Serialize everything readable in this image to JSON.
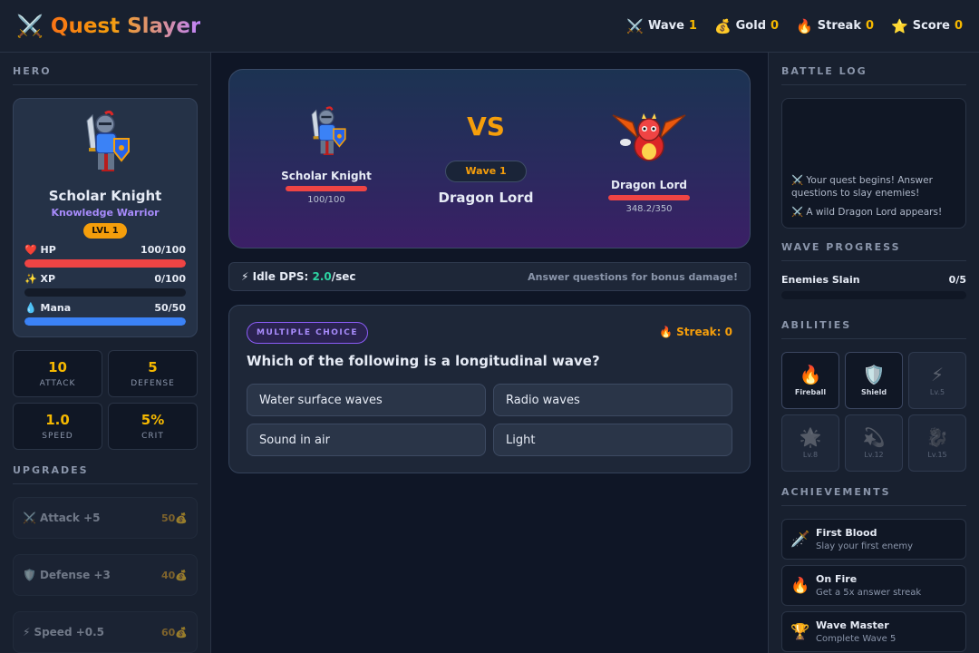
{
  "app": {
    "title": "Quest Slayer",
    "icon": "crossed-swords-icon"
  },
  "header": {
    "stats": [
      {
        "icon": "⚔️",
        "label": "Wave",
        "value": "1"
      },
      {
        "icon": "💰",
        "label": "Gold",
        "value": "0"
      },
      {
        "icon": "🔥",
        "label": "Streak",
        "value": "0"
      },
      {
        "icon": "⭐",
        "label": "Score",
        "value": "0"
      }
    ]
  },
  "hero": {
    "section_title": "HERO",
    "name": "Scholar Knight",
    "class": "Knowledge Warrior",
    "level": "LVL 1",
    "bars": [
      {
        "icon": "❤️",
        "label": "HP",
        "value": "100/100",
        "fraction": 1.0,
        "color": "#ef4444"
      },
      {
        "icon": "✨",
        "label": "XP",
        "value": "0/100",
        "fraction": 0.0,
        "color": "#f59e0b"
      },
      {
        "icon": "💧",
        "label": "Mana",
        "value": "50/50",
        "fraction": 1.0,
        "color": "#3b82f6"
      }
    ],
    "stats": [
      {
        "value": "10",
        "label": "ATTACK"
      },
      {
        "value": "5",
        "label": "DEFENSE"
      },
      {
        "value": "1.0",
        "label": "SPEED"
      },
      {
        "value": "5%",
        "label": "CRIT"
      }
    ]
  },
  "upgrades": {
    "section_title": "UPGRADES",
    "items": [
      {
        "icon": "⚔️",
        "label": "Attack +5",
        "cost": "50💰"
      },
      {
        "icon": "🛡️",
        "label": "Defense +3",
        "cost": "40💰"
      },
      {
        "icon": "⚡",
        "label": "Speed +0.5",
        "cost": "60💰"
      }
    ]
  },
  "battle": {
    "hero_name": "Scholar Knight",
    "hero_hp": "100/100",
    "hero_hp_fraction": 1.0,
    "vs": "VS",
    "wave": "Wave 1",
    "enemy_title": "Dragon Lord",
    "enemy_name": "Dragon Lord",
    "enemy_hp": "348.2/350",
    "enemy_hp_fraction": 0.995
  },
  "idle": {
    "icon": "⚡",
    "label": "Idle DPS:",
    "value": "2.0",
    "unit": "/sec",
    "hint": "Answer questions for bonus damage!"
  },
  "question": {
    "type": "MULTIPLE CHOICE",
    "streak": "🔥 Streak: 0",
    "text": "Which of the following is a longitudinal wave?",
    "answers": [
      "Water surface waves",
      "Radio waves",
      "Sound in air",
      "Light"
    ]
  },
  "battle_log": {
    "section_title": "BATTLE LOG",
    "entries": [
      "⚔️ Your quest begins! Answer questions to slay enemies!",
      "⚔️ A wild Dragon Lord appears!"
    ]
  },
  "wave_progress": {
    "section_title": "WAVE PROGRESS",
    "label": "Enemies Slain",
    "value": "0/5",
    "fraction": 0.0
  },
  "abilities": {
    "section_title": "ABILITIES",
    "items": [
      {
        "icon": "🔥",
        "label": "Fireball",
        "unlocked": true
      },
      {
        "icon": "🛡️",
        "label": "Shield",
        "unlocked": true
      },
      {
        "icon": "⚡",
        "label": "Lv.5",
        "unlocked": false
      },
      {
        "icon": "🌟",
        "label": "Lv.8",
        "unlocked": false
      },
      {
        "icon": "💫",
        "label": "Lv.12",
        "unlocked": false
      },
      {
        "icon": "🐉",
        "label": "Lv.15",
        "unlocked": false
      }
    ]
  },
  "achievements": {
    "section_title": "ACHIEVEMENTS",
    "items": [
      {
        "icon": "🗡️",
        "title": "First Blood",
        "desc": "Slay your first enemy"
      },
      {
        "icon": "🔥",
        "title": "On Fire",
        "desc": "Get a 5x answer streak"
      },
      {
        "icon": "🏆",
        "title": "Wave Master",
        "desc": "Complete Wave 5"
      }
    ]
  }
}
